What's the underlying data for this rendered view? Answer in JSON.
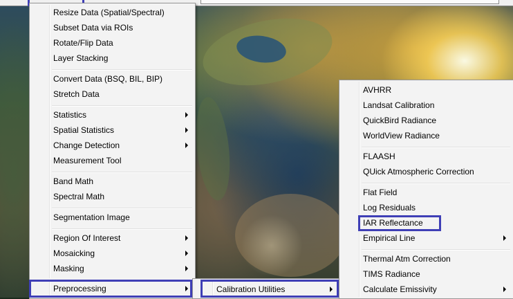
{
  "main_menu": {
    "items": [
      {
        "label": "Resize Data (Spatial/Spectral)",
        "submenu": false
      },
      {
        "label": "Subset Data via ROIs",
        "submenu": false
      },
      {
        "label": "Rotate/Flip Data",
        "submenu": false
      },
      {
        "label": "Layer Stacking",
        "submenu": false
      },
      {
        "label": "Convert Data (BSQ, BIL, BIP)",
        "submenu": false
      },
      {
        "label": "Stretch Data",
        "submenu": false
      },
      {
        "label": "Statistics",
        "submenu": true
      },
      {
        "label": "Spatial Statistics",
        "submenu": true
      },
      {
        "label": "Change Detection",
        "submenu": true
      },
      {
        "label": "Measurement Tool",
        "submenu": false
      },
      {
        "label": "Band Math",
        "submenu": false
      },
      {
        "label": "Spectral Math",
        "submenu": false
      },
      {
        "label": "Segmentation Image",
        "submenu": false
      },
      {
        "label": "Region Of Interest",
        "submenu": true
      },
      {
        "label": "Mosaicking",
        "submenu": true
      },
      {
        "label": "Masking",
        "submenu": true
      },
      {
        "label": "Preprocessing",
        "submenu": true
      }
    ]
  },
  "preprocessing_menu": {
    "items": [
      {
        "label": "Calibration Utilities",
        "submenu": true
      }
    ]
  },
  "calibration_menu": {
    "items": [
      {
        "label": "AVHRR",
        "submenu": false
      },
      {
        "label": "Landsat Calibration",
        "submenu": false
      },
      {
        "label": "QuickBird Radiance",
        "submenu": false
      },
      {
        "label": "WorldView Radiance",
        "submenu": false
      },
      {
        "label": "FLAASH",
        "submenu": false
      },
      {
        "label": "QUick Atmospheric Correction",
        "submenu": false
      },
      {
        "label": "Flat Field",
        "submenu": false
      },
      {
        "label": "Log Residuals",
        "submenu": false
      },
      {
        "label": "IAR Reflectance",
        "submenu": false
      },
      {
        "label": "Empirical Line",
        "submenu": true
      },
      {
        "label": "Thermal Atm Correction",
        "submenu": false
      },
      {
        "label": "TIMS Radiance",
        "submenu": false
      },
      {
        "label": "Calculate Emissivity",
        "submenu": true
      }
    ]
  },
  "colors": {
    "highlight_border": "#3f3fb6",
    "menu_background": "#f3f3f3"
  }
}
